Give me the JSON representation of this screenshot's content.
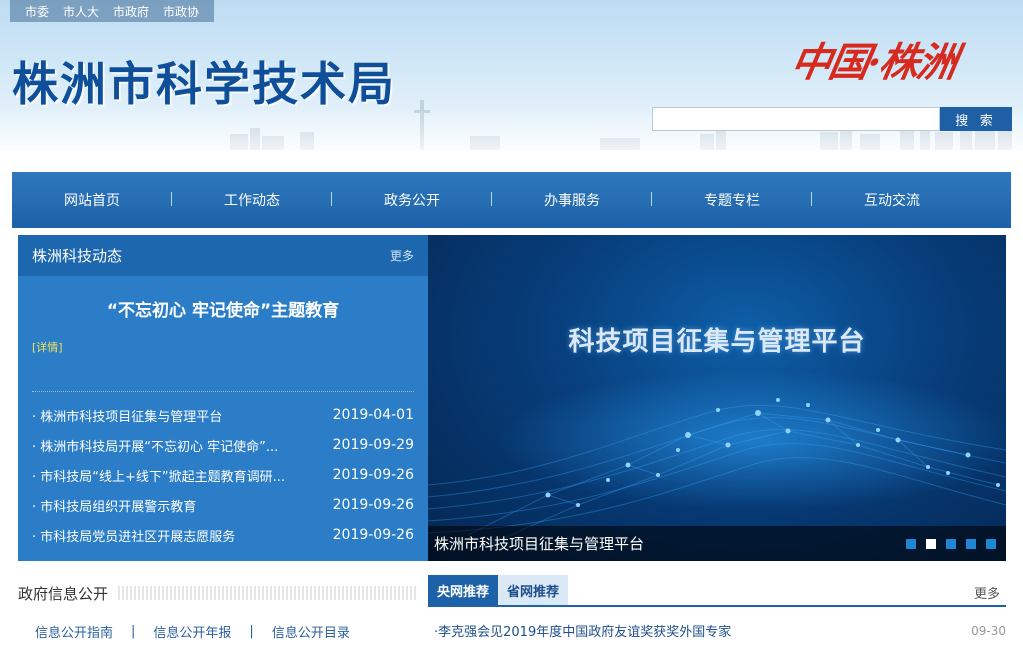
{
  "header": {
    "top_links": [
      "市委",
      "市人大",
      "市政府",
      "市政协"
    ],
    "site_title": "株洲市科学技术局",
    "brand_logo": "中国·株洲",
    "search": {
      "placeholder": "",
      "button_label": "搜 索"
    }
  },
  "nav": {
    "items": [
      "网站首页",
      "工作动态",
      "政务公开",
      "办事服务",
      "专题专栏",
      "互动交流"
    ]
  },
  "news": {
    "title": "株洲科技动态",
    "more": "更多",
    "feature_title": "“不忘初心 牢记使命”主题教育",
    "feature_detail": "[详情]",
    "items": [
      {
        "text": "· 株洲市科技项目征集与管理平台",
        "date": "2019-04-01"
      },
      {
        "text": "· 株洲市科技局开展“不忘初心 牢记使命”...",
        "date": "2019-09-29"
      },
      {
        "text": "· 市科技局“线上+线下”掀起主题教育调研...",
        "date": "2019-09-26"
      },
      {
        "text": "· 市科技局组织开展警示教育",
        "date": "2019-09-26"
      },
      {
        "text": "· 市科技局党员进社区开展志愿服务",
        "date": "2019-09-26"
      }
    ]
  },
  "slider": {
    "heading": "科技项目征集与管理平台",
    "caption": "株洲市科技项目征集与管理平台",
    "active_index": 1,
    "dot_count": 5
  },
  "gov_info": {
    "title": "政府信息公开",
    "links": [
      "信息公开指南",
      "信息公开年报",
      "信息公开目录"
    ]
  },
  "recommend": {
    "tabs": [
      "央网推荐",
      "省网推荐"
    ],
    "active_tab": 0,
    "more": "更多",
    "items": [
      {
        "text": "·李克强会见2019年度中国政府友谊奖获奖外国专家",
        "date": "09-30"
      }
    ]
  },
  "colors": {
    "nav_blue": "#1d62a8",
    "panel_blue": "#2a7dc6",
    "brand_red": "#d62a1e",
    "detail_yellow": "#f2e35a"
  }
}
